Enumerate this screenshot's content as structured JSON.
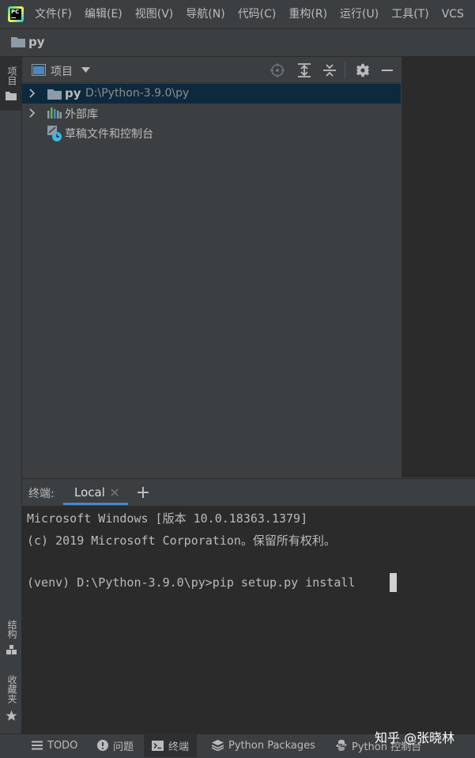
{
  "menu": {
    "items": [
      "文件(F)",
      "编辑(E)",
      "视图(V)",
      "导航(N)",
      "代码(C)",
      "重构(R)",
      "运行(U)",
      "工具(T)",
      "VCS"
    ],
    "logo_text": "PC"
  },
  "breadcrumb": {
    "project": "py"
  },
  "left_strip": {
    "project_tab": "项目",
    "structure_tab": "结构",
    "favorites_tab": "收藏夹"
  },
  "project_panel": {
    "title": "项目",
    "tree": [
      {
        "name": "py",
        "path": "D:\\Python-3.9.0\\py"
      },
      {
        "name": "外部库"
      },
      {
        "name": "草稿文件和控制台"
      }
    ]
  },
  "terminal": {
    "label": "终端:",
    "tab_name": "Local",
    "lines": [
      "Microsoft Windows [版本 10.0.18363.1379]",
      "(c) 2019 Microsoft Corporation。保留所有权利。",
      "",
      "(venv) D:\\Python-3.9.0\\py>pip setup.py install"
    ]
  },
  "bottom_tabs": [
    "TODO",
    "问题",
    "终端",
    "Python Packages",
    "Python 控制台"
  ],
  "watermark": "知乎 @张晓林",
  "colors": {
    "background": "#3c3f41",
    "editor": "#2b2b2b",
    "selection": "#0d293e",
    "folder": "#8c9ba7",
    "accent": "#4a88c7"
  }
}
